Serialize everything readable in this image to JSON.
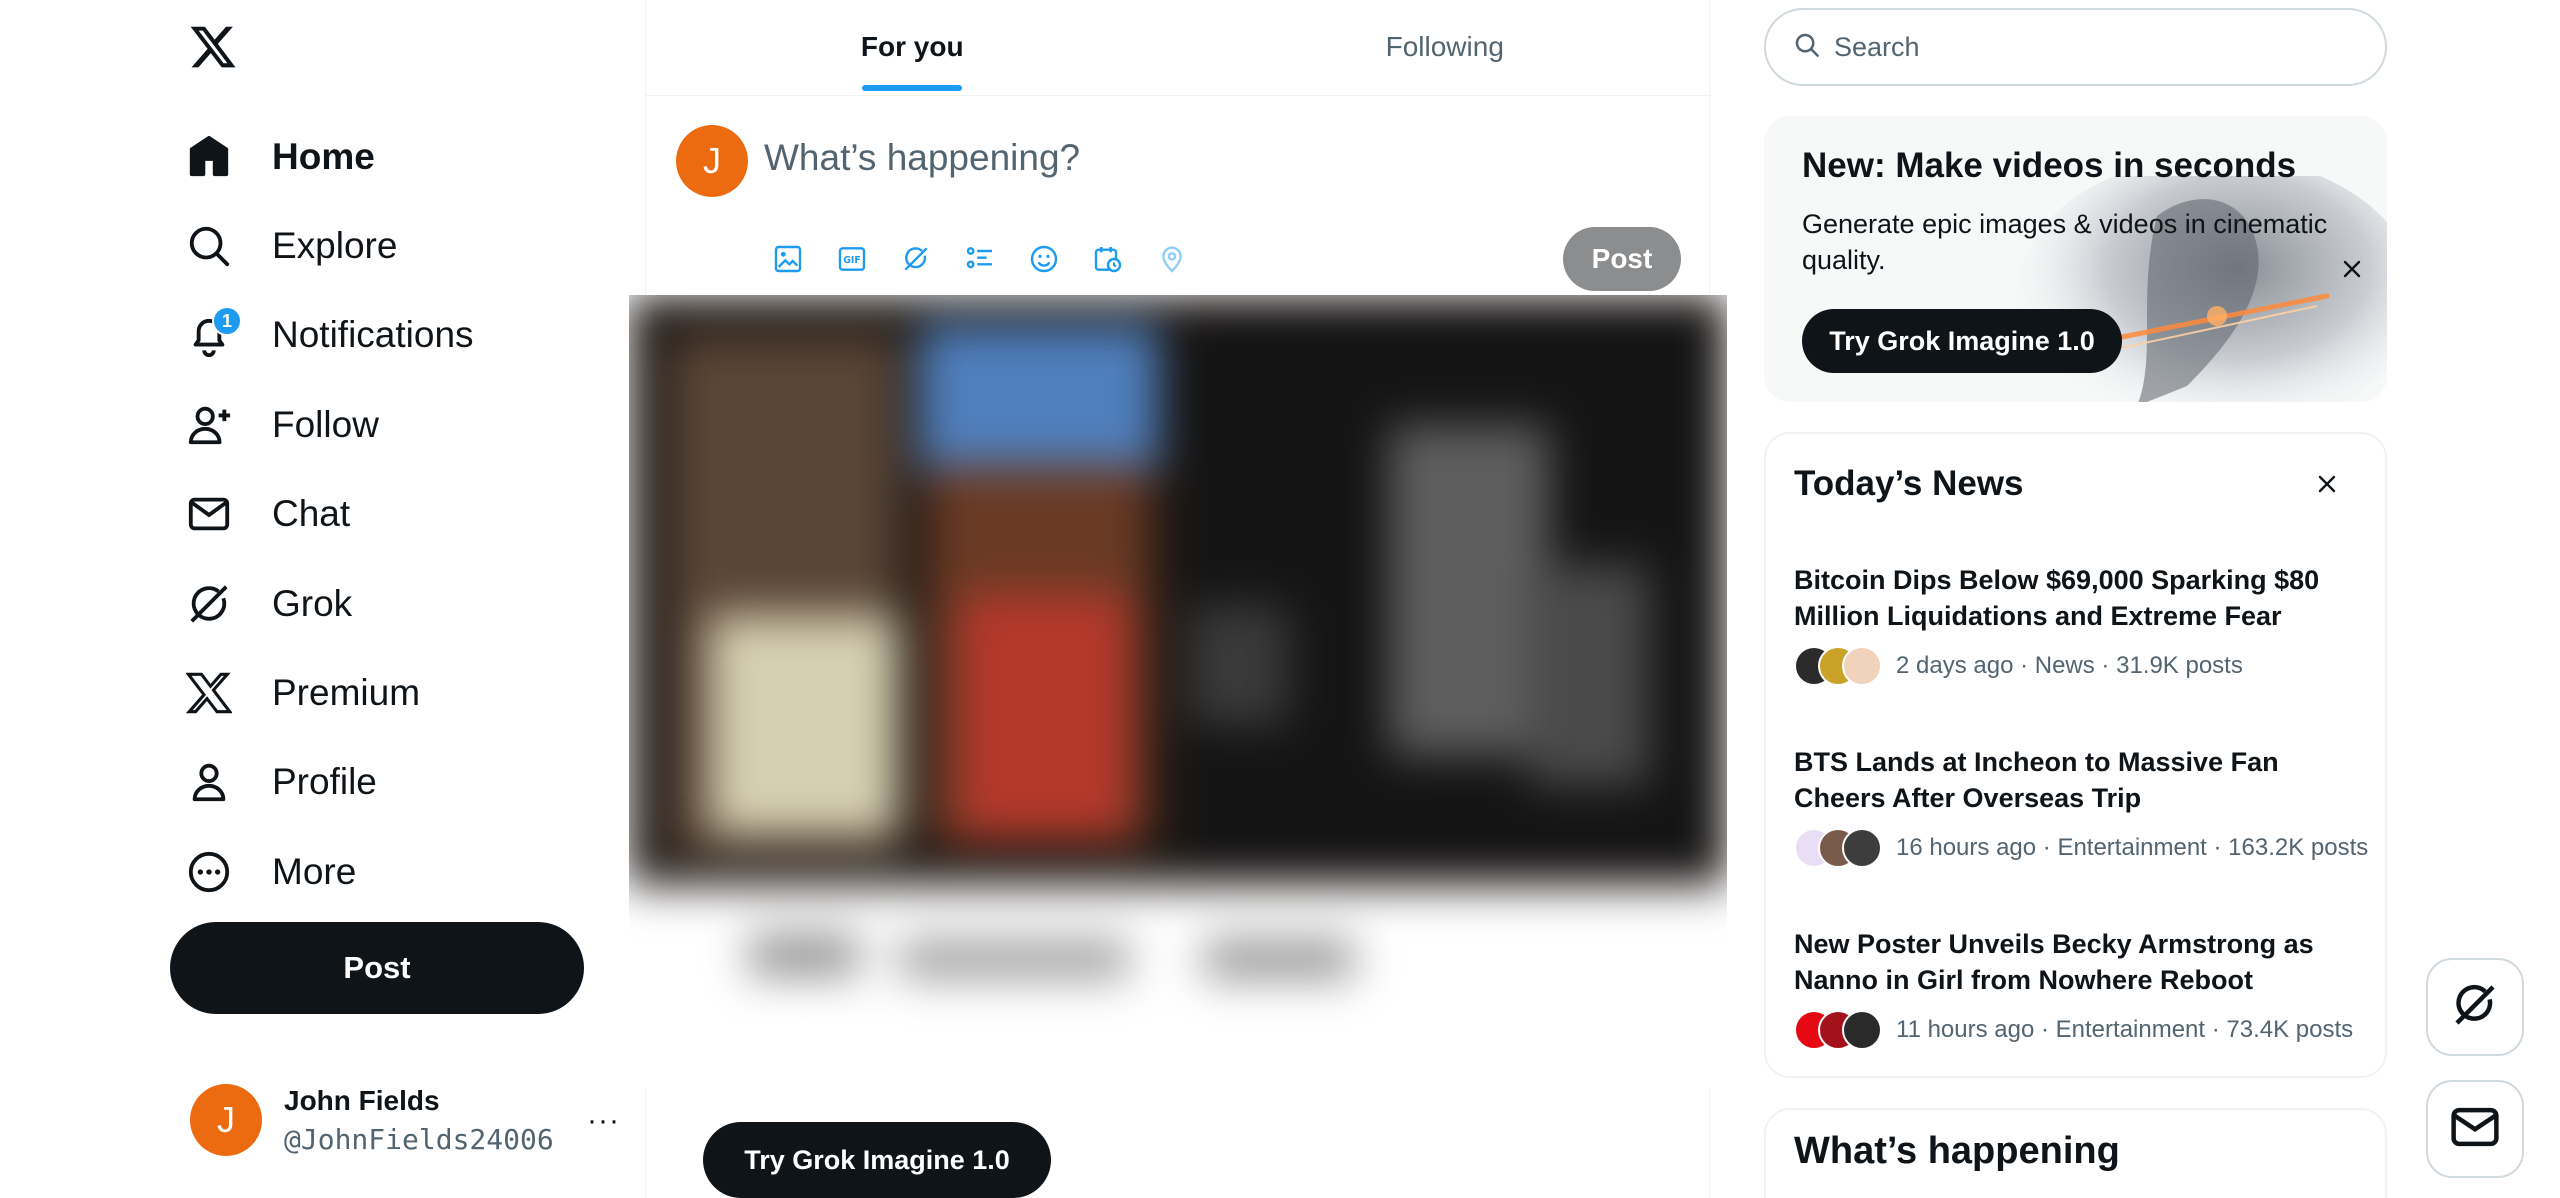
{
  "nav": {
    "items": [
      {
        "label": "Home",
        "icon": "home-icon",
        "active": true
      },
      {
        "label": "Explore",
        "icon": "search-icon"
      },
      {
        "label": "Notifications",
        "icon": "bell-icon",
        "badge": "1"
      },
      {
        "label": "Follow",
        "icon": "person-add-icon"
      },
      {
        "label": "Chat",
        "icon": "envelope-icon"
      },
      {
        "label": "Grok",
        "icon": "grok-icon"
      },
      {
        "label": "Premium",
        "icon": "x-logo-icon"
      },
      {
        "label": "Profile",
        "icon": "person-icon"
      },
      {
        "label": "More",
        "icon": "more-circle-icon"
      }
    ],
    "post_label": "Post"
  },
  "account": {
    "initial": "J",
    "name": "John Fields",
    "handle": "@JohnFields24006",
    "more": "···"
  },
  "tabs": [
    {
      "label": "For you",
      "active": true
    },
    {
      "label": "Following"
    }
  ],
  "composer": {
    "initial": "J",
    "placeholder": "What’s happening?",
    "tools": [
      "image-icon",
      "gif-icon",
      "grok-icon",
      "poll-icon",
      "emoji-icon",
      "schedule-icon",
      "location-icon"
    ],
    "post_label": "Post"
  },
  "main_cta": "Try Grok Imagine 1.0",
  "search": {
    "placeholder": "Search"
  },
  "promo": {
    "title": "New: Make videos in seconds",
    "text": "Generate epic images & videos in cinematic quality.",
    "button": "Try Grok Imagine 1.0"
  },
  "news": {
    "title": "Today’s News",
    "items": [
      {
        "headline": "Bitcoin Dips Below $69,000 Sparking $80 Million Liquidations and Extreme Fear",
        "meta": "2 days ago · News · 31.9K posts"
      },
      {
        "headline": "BTS Lands at Incheon to Massive Fan Cheers After Overseas Trip",
        "meta": "16 hours ago · Entertainment · 163.2K posts"
      },
      {
        "headline": "New Poster Unveils Becky Armstrong as Nanno in Girl from Nowhere Reboot",
        "meta": "11 hours ago · Entertainment · 73.4K posts"
      }
    ]
  },
  "happening": {
    "title": "What’s happening"
  },
  "colors": {
    "accent": "#1d9bf0",
    "dark": "#0f1419",
    "avatar": "#ec6a10",
    "muted": "#536471"
  }
}
